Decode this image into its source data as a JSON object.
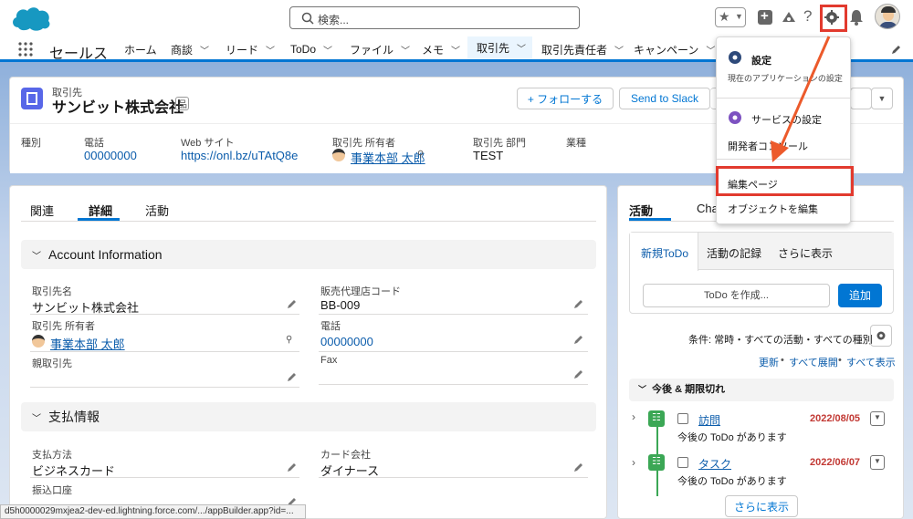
{
  "search": {
    "placeholder": "検索..."
  },
  "app": {
    "name": "セールス"
  },
  "nav": {
    "items": [
      {
        "label": "ホーム",
        "has_menu": false
      },
      {
        "label": "商談",
        "has_menu": true
      },
      {
        "label": "リード",
        "has_menu": true
      },
      {
        "label": "ToDo",
        "has_menu": true
      },
      {
        "label": "ファイル",
        "has_menu": true
      },
      {
        "label": "メモ",
        "has_menu": true
      },
      {
        "label": "取引先",
        "has_menu": true
      },
      {
        "label": "取引先責任者",
        "has_menu": true
      },
      {
        "label": "キャンペーン",
        "has_menu": true
      }
    ]
  },
  "record": {
    "object_label": "取引先",
    "name": "サンビット株式会社",
    "follow_label": "+ フォローする",
    "slack_label": "Send to Slack",
    "fields": {
      "type_label": "種別",
      "type_value": "",
      "phone_label": "電話",
      "phone_value": "00000000",
      "web_label": "Web サイト",
      "web_value": "https://onl.bz/uTAtQ8e",
      "owner_label": "取引先 所有者",
      "owner_value": "事業本部 太郎",
      "dept_label": "取引先 部門",
      "dept_value": "TEST",
      "industry_label": "業種",
      "industry_value": ""
    }
  },
  "detail": {
    "tabs": [
      "関連",
      "詳細",
      "活動"
    ],
    "section1_title": "Account Information",
    "section2_title": "支払情報",
    "account_name_label": "取引先名",
    "account_name_value": "サンビット株式会社",
    "agency_label": "販売代理店コード",
    "agency_value": "BB-009",
    "owner_label": "取引先 所有者",
    "owner_value": "事業本部 太郎",
    "phone_label": "電話",
    "phone_value": "00000000",
    "parent_label": "親取引先",
    "fax_label": "Fax",
    "payment_label": "支払方法",
    "payment_value": "ビジネスカード",
    "card_label": "カード会社",
    "card_value": "ダイナース",
    "bank_label": "振込口座"
  },
  "activity": {
    "tab_active": "活動",
    "tab_other": "Cha",
    "subtabs": [
      "新規ToDo",
      "活動の記録",
      "さらに表示"
    ],
    "todo_placeholder": "ToDo を作成...",
    "add_label": "追加",
    "filter_text": "条件: 常時・すべての活動・すべての種別",
    "links": [
      "更新",
      "すべて展開",
      "すべて表示"
    ],
    "upcoming_title": "今後 & 期限切れ",
    "items": [
      {
        "title": "訪問",
        "date": "2022/08/05",
        "sub": "今後の ToDo があります"
      },
      {
        "title": "タスク",
        "date": "2022/06/07",
        "sub": "今後の ToDo があります"
      }
    ],
    "more_label": "さらに表示"
  },
  "setup_menu": {
    "setup_title": "設定",
    "setup_sub": "現在のアプリケーションの設定",
    "service_setup": "サービスの設定",
    "dev_console": "開発者コンソール",
    "edit_page": "編集ページ",
    "edit_object": "オブジェクトを編集"
  },
  "status_bar": {
    "url": "d5h0000029mxjea2-dev-ed.lightning.force.com/.../appBuilder.app?id=..."
  },
  "colors": {
    "brand": "#0176d3",
    "highlight": "#e23a2e",
    "todo": "#3ba755"
  }
}
